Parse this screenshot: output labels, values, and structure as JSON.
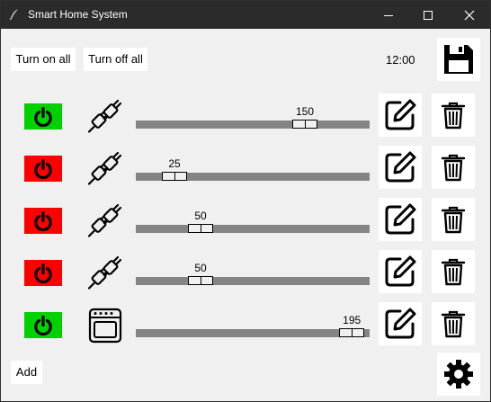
{
  "window": {
    "title": "Smart Home System"
  },
  "toolbar": {
    "turn_on_all_label": "Turn on all",
    "turn_off_all_label": "Turn off all",
    "time": "12:00",
    "add_label": "Add"
  },
  "colors": {
    "on": "#00d200",
    "off": "#ff0000"
  },
  "devices": [
    {
      "power": "on",
      "icon": "plug-icon",
      "value": 150,
      "max": 200
    },
    {
      "power": "off",
      "icon": "plug-icon",
      "value": 25,
      "max": 200
    },
    {
      "power": "off",
      "icon": "plug-icon",
      "value": 50,
      "max": 200
    },
    {
      "power": "off",
      "icon": "plug-icon",
      "value": 50,
      "max": 200
    },
    {
      "power": "on",
      "icon": "oven-icon",
      "value": 195,
      "max": 200
    }
  ]
}
